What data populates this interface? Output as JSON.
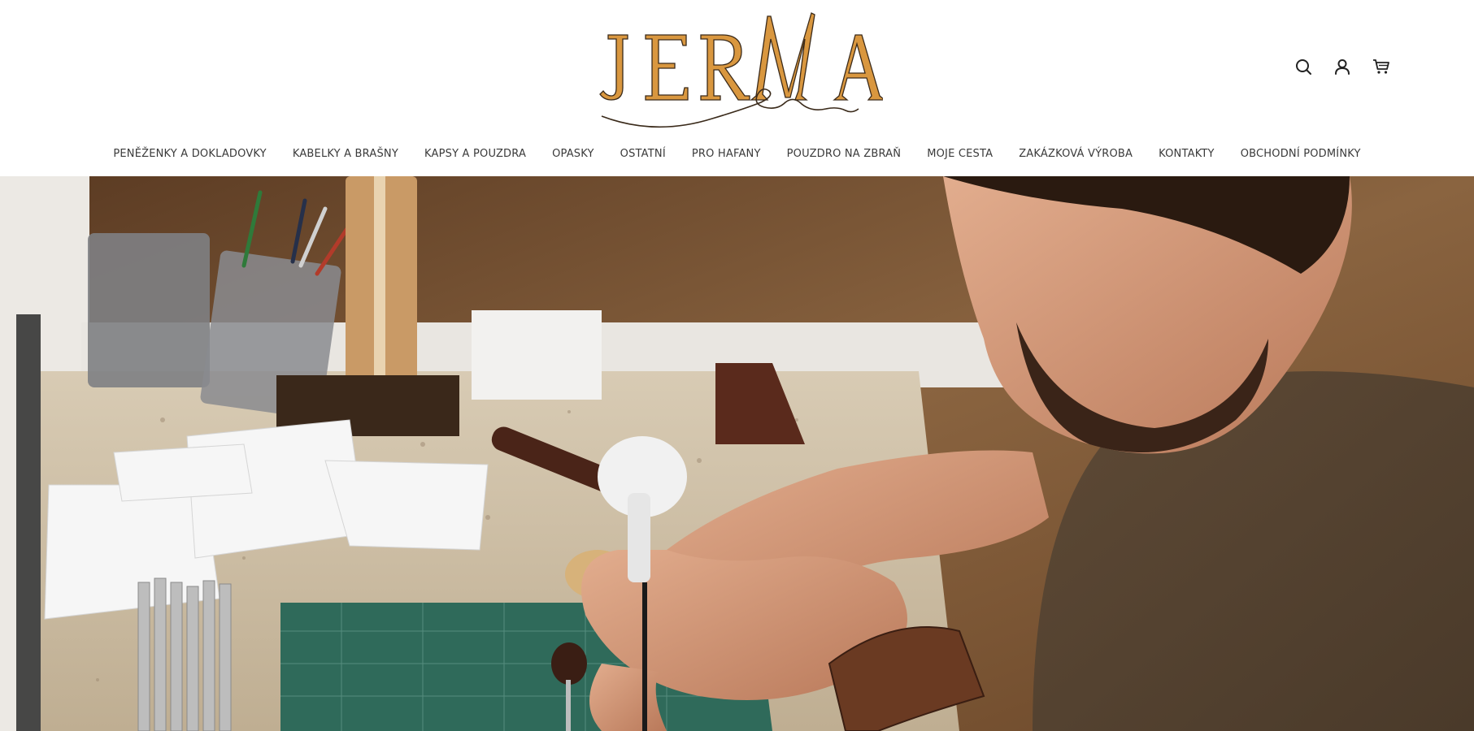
{
  "brand": {
    "logo_text": "JERMA"
  },
  "header_icons": [
    {
      "name": "search-icon"
    },
    {
      "name": "user-icon"
    },
    {
      "name": "cart-icon"
    }
  ],
  "nav": {
    "items": [
      {
        "label": "PENĚŽENKY A DOKLADOVKY"
      },
      {
        "label": "KABELKY A BRAŠNY"
      },
      {
        "label": "KAPSY A POUZDRA"
      },
      {
        "label": "OPASKY"
      },
      {
        "label": "OSTATNÍ"
      },
      {
        "label": "PRO HAFANY"
      },
      {
        "label": "POUZDRO NA ZBRAŇ"
      },
      {
        "label": "MOJE CESTA"
      },
      {
        "label": "ZAKÁZKOVÁ VÝROBA"
      },
      {
        "label": "KONTAKTY"
      },
      {
        "label": "OBCHODNÍ PODMÍNKY"
      }
    ]
  },
  "colors": {
    "logo_gold": "#d9973f",
    "logo_outline": "#3a2a1a",
    "nav_text": "#3a3a3a",
    "hero_wall": "#6f4a2c",
    "hero_shirt": "#5a4634"
  }
}
